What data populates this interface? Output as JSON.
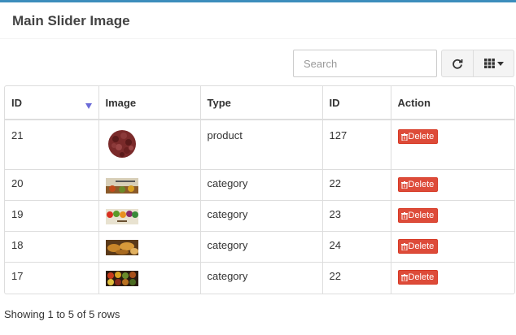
{
  "panel": {
    "title": "Main Slider Image"
  },
  "toolbar": {
    "search_placeholder": "Search",
    "refresh_icon": "refresh-icon",
    "columns_icon": "grid-columns-icon"
  },
  "table": {
    "headers": [
      "ID",
      "Image",
      "Type",
      "ID",
      "Action"
    ],
    "sort_indicator": "sort-descending-icon",
    "rows": [
      {
        "id": "21",
        "image": "coffee-beans-thumbnail",
        "type": "product",
        "ref_id": "127",
        "action": "Delete"
      },
      {
        "id": "20",
        "image": "food-banner-thumbnail",
        "type": "category",
        "ref_id": "22",
        "action": "Delete"
      },
      {
        "id": "19",
        "image": "vegetables-banner-thumbnail",
        "type": "category",
        "ref_id": "23",
        "action": "Delete"
      },
      {
        "id": "18",
        "image": "bakery-banner-thumbnail",
        "type": "category",
        "ref_id": "24",
        "action": "Delete"
      },
      {
        "id": "17",
        "image": "spices-banner-thumbnail",
        "type": "category",
        "ref_id": "22",
        "action": "Delete"
      }
    ]
  },
  "footer": {
    "info": "Showing 1 to 5 of 5 rows"
  },
  "colors": {
    "accent": "#3c8dbc",
    "danger": "#dd4b39",
    "sort_caret": "#6b6bd8"
  }
}
